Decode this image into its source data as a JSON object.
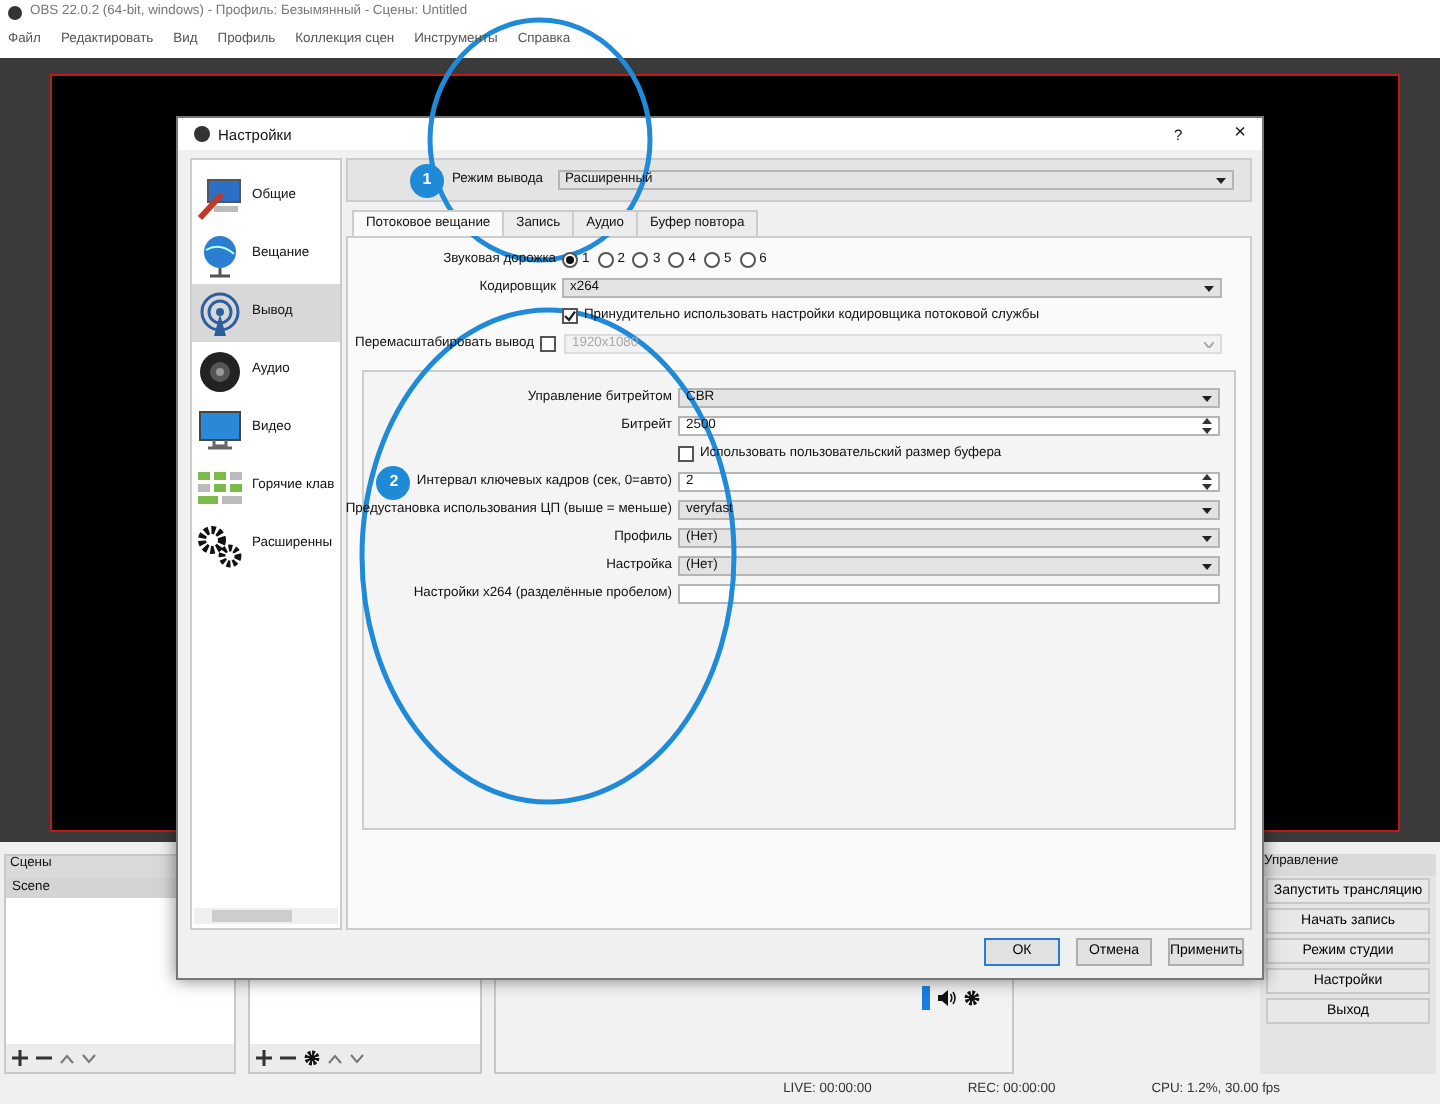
{
  "window": {
    "title": "OBS 22.0.2 (64-bit, windows) - Профиль: Безымянный - Сцены: Untitled"
  },
  "menu": [
    "Файл",
    "Редактировать",
    "Вид",
    "Профиль",
    "Коллекция сцен",
    "Инструменты",
    "Справка"
  ],
  "scenes": {
    "title": "Сцены",
    "items": [
      {
        "label": "Scene",
        "selected": true
      }
    ]
  },
  "controls": {
    "title": "Управление",
    "buttons": [
      "Запустить трансляцию",
      "Начать запись",
      "Режим студии",
      "Настройки",
      "Выход"
    ]
  },
  "status_bar": [
    "LIVE: 00:00:00",
    "REC: 00:00:00",
    "CPU: 1.2%, 30.00 fps"
  ],
  "dialog": {
    "title": "Настройки",
    "help": "?",
    "close": "×",
    "sidebar": [
      {
        "label": "Общие",
        "kind": "general",
        "selected": false
      },
      {
        "label": "Вещание",
        "kind": "stream",
        "selected": false
      },
      {
        "label": "Вывод",
        "kind": "output",
        "selected": true
      },
      {
        "label": "Аудио",
        "kind": "audio",
        "selected": false
      },
      {
        "label": "Видео",
        "kind": "video",
        "selected": false
      },
      {
        "label": "Горячие клав",
        "kind": "hotkeys",
        "selected": false
      },
      {
        "label": "Расширенны",
        "kind": "advanced",
        "selected": false
      }
    ],
    "output_mode": {
      "badge": "1",
      "label": "Режим вывода",
      "value": "Расширенный"
    },
    "tabs": [
      {
        "label": "Потоковое вещание",
        "selected": true
      },
      {
        "label": "Запись",
        "selected": false
      },
      {
        "label": "Аудио",
        "selected": false
      },
      {
        "label": "Буфер повтора",
        "selected": false
      }
    ],
    "stream_rows": [
      {
        "kind": "radios",
        "label": "Звуковая дорожка",
        "options": [
          {
            "label": "1",
            "selected": true
          },
          {
            "label": "2",
            "selected": false
          },
          {
            "label": "3",
            "selected": false
          },
          {
            "label": "4",
            "selected": false
          },
          {
            "label": "5",
            "selected": false
          },
          {
            "label": "6",
            "selected": false
          }
        ]
      },
      {
        "kind": "select",
        "label": "Кодировщик",
        "value": "x264"
      },
      {
        "kind": "check",
        "label": "Принудительно использовать настройки кодировщика потоковой службы",
        "checked": true
      },
      {
        "kind": "rescale",
        "label": "Перемасштабировать вывод",
        "checked": false,
        "value": "1920x1080"
      }
    ],
    "encoder_rows": [
      {
        "kind": "select",
        "label": "Управление битрейтом",
        "value": "CBR"
      },
      {
        "kind": "spin",
        "label": "Битрейт",
        "value": "2500"
      },
      {
        "kind": "check",
        "label": "Использовать пользовательский размер буфера",
        "checked": false
      },
      {
        "kind": "spin",
        "label": "Интервал ключевых кадров (сек, 0=авто)",
        "value": "2",
        "badge": "2"
      },
      {
        "kind": "select",
        "label": "Предустановка использования ЦП (выше = меньше)",
        "value": "veryfast"
      },
      {
        "kind": "select",
        "label": "Профиль",
        "value": "(Нет)"
      },
      {
        "kind": "select",
        "label": "Настройка",
        "value": "(Нет)"
      },
      {
        "kind": "text",
        "label": "Настройки x264 (разделённые пробелом)",
        "value": ""
      }
    ],
    "buttons": [
      {
        "label": "ОК",
        "default": true
      },
      {
        "label": "Отмена",
        "default": false
      },
      {
        "label": "Применить",
        "default": false
      }
    ]
  }
}
